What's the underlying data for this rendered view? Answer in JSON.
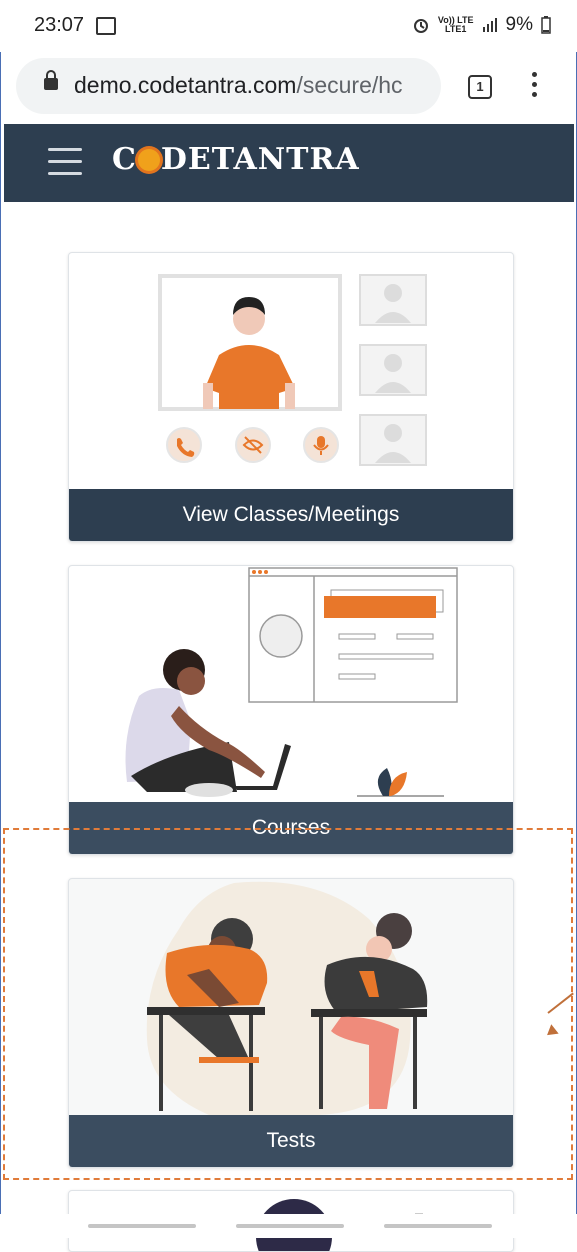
{
  "status_bar": {
    "time": "23:07",
    "network_top": "Vo)) LTE",
    "network_bottom": "LTE1",
    "battery": "9%"
  },
  "browser": {
    "url_host": "demo.codetantra.com",
    "url_path": "/secure/hc",
    "tab_count": "1"
  },
  "app": {
    "logo_text_pre": "C",
    "logo_text_post": "DETANTRA"
  },
  "cards": [
    {
      "label": "View Classes/Meetings"
    },
    {
      "label": "Courses"
    },
    {
      "label": "Tests"
    }
  ],
  "colors": {
    "header": "#2d3e50",
    "accent": "#e8772a",
    "highlight_dash": "#e07b3a"
  }
}
